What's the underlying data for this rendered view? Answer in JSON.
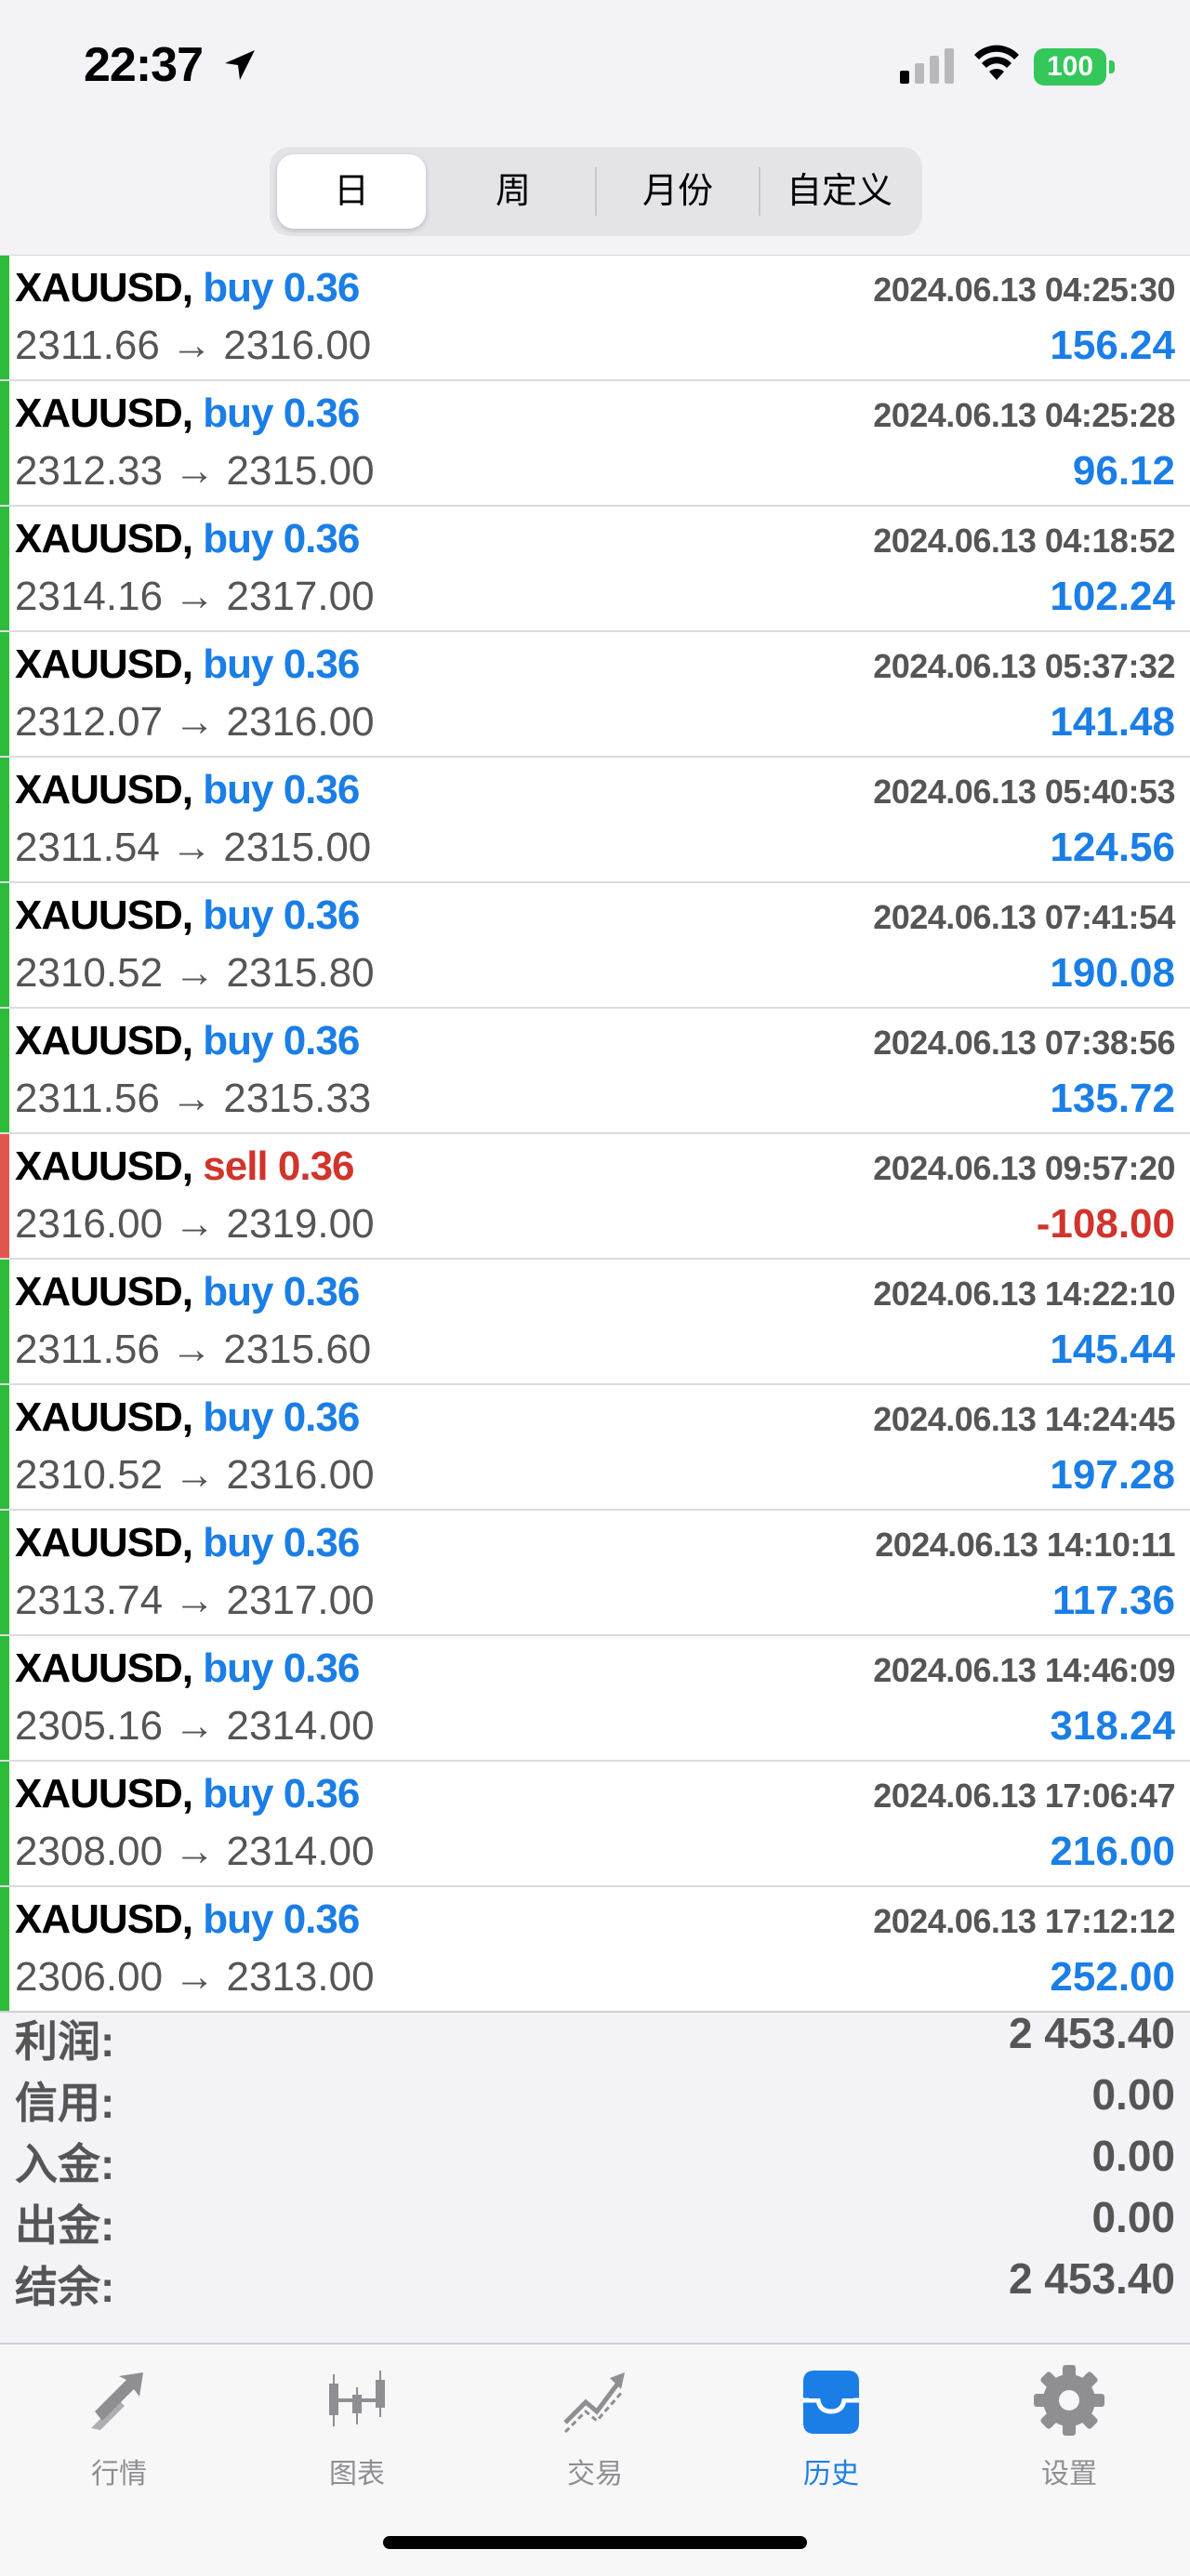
{
  "status_bar": {
    "time": "22:37",
    "battery": "100"
  },
  "tabs": [
    "日",
    "周",
    "月份",
    "自定义"
  ],
  "active_tab_index": 0,
  "colors": {
    "buy": "#1a7ee6",
    "sell": "#d0342c",
    "profit_positive": "#1a7ee6",
    "profit_negative": "#d0342c",
    "bar_buy": "#2dbb3a",
    "bar_sell": "#e0564f"
  },
  "deals": [
    {
      "symbol": "XAUUSD,",
      "side": "buy 0.36",
      "time": "2024.06.13 04:25:30",
      "prices": "2311.66 → 2316.00",
      "profit": "156.24",
      "type": "buy"
    },
    {
      "symbol": "XAUUSD,",
      "side": "buy 0.36",
      "time": "2024.06.13 04:25:28",
      "prices": "2312.33 → 2315.00",
      "profit": "96.12",
      "type": "buy"
    },
    {
      "symbol": "XAUUSD,",
      "side": "buy 0.36",
      "time": "2024.06.13 04:18:52",
      "prices": "2314.16 → 2317.00",
      "profit": "102.24",
      "type": "buy"
    },
    {
      "symbol": "XAUUSD,",
      "side": "buy 0.36",
      "time": "2024.06.13 05:37:32",
      "prices": "2312.07 → 2316.00",
      "profit": "141.48",
      "type": "buy"
    },
    {
      "symbol": "XAUUSD,",
      "side": "buy 0.36",
      "time": "2024.06.13 05:40:53",
      "prices": "2311.54 → 2315.00",
      "profit": "124.56",
      "type": "buy"
    },
    {
      "symbol": "XAUUSD,",
      "side": "buy 0.36",
      "time": "2024.06.13 07:41:54",
      "prices": "2310.52 → 2315.80",
      "profit": "190.08",
      "type": "buy"
    },
    {
      "symbol": "XAUUSD,",
      "side": "buy 0.36",
      "time": "2024.06.13 07:38:56",
      "prices": "2311.56 → 2315.33",
      "profit": "135.72",
      "type": "buy"
    },
    {
      "symbol": "XAUUSD,",
      "side": "sell 0.36",
      "time": "2024.06.13 09:57:20",
      "prices": "2316.00 → 2319.00",
      "profit": "-108.00",
      "type": "sell"
    },
    {
      "symbol": "XAUUSD,",
      "side": "buy 0.36",
      "time": "2024.06.13 14:22:10",
      "prices": "2311.56 → 2315.60",
      "profit": "145.44",
      "type": "buy"
    },
    {
      "symbol": "XAUUSD,",
      "side": "buy 0.36",
      "time": "2024.06.13 14:24:45",
      "prices": "2310.52 → 2316.00",
      "profit": "197.28",
      "type": "buy"
    },
    {
      "symbol": "XAUUSD,",
      "side": "buy 0.36",
      "time": "2024.06.13 14:10:11",
      "prices": "2313.74 → 2317.00",
      "profit": "117.36",
      "type": "buy"
    },
    {
      "symbol": "XAUUSD,",
      "side": "buy 0.36",
      "time": "2024.06.13 14:46:09",
      "prices": "2305.16 → 2314.00",
      "profit": "318.24",
      "type": "buy"
    },
    {
      "symbol": "XAUUSD,",
      "side": "buy 0.36",
      "time": "2024.06.13 17:06:47",
      "prices": "2308.00 → 2314.00",
      "profit": "216.00",
      "type": "buy"
    },
    {
      "symbol": "XAUUSD,",
      "side": "buy 0.36",
      "time": "2024.06.13 17:12:12",
      "prices": "2306.00 → 2313.00",
      "profit": "252.00",
      "type": "buy"
    }
  ],
  "summary": [
    {
      "label": "利润:",
      "value": "2 453.40"
    },
    {
      "label": "信用:",
      "value": "0.00"
    },
    {
      "label": "入金:",
      "value": "0.00"
    },
    {
      "label": "出金:",
      "value": "0.00"
    },
    {
      "label": "结余:",
      "value": "2 453.40"
    }
  ],
  "tabbar": [
    {
      "label": "行情",
      "icon": "quotes-arrows-icon"
    },
    {
      "label": "图表",
      "icon": "candlestick-chart-icon"
    },
    {
      "label": "交易",
      "icon": "trade-trend-icon"
    },
    {
      "label": "历史",
      "icon": "history-inbox-icon"
    },
    {
      "label": "设置",
      "icon": "gear-icon"
    }
  ],
  "tabbar_active_index": 3
}
